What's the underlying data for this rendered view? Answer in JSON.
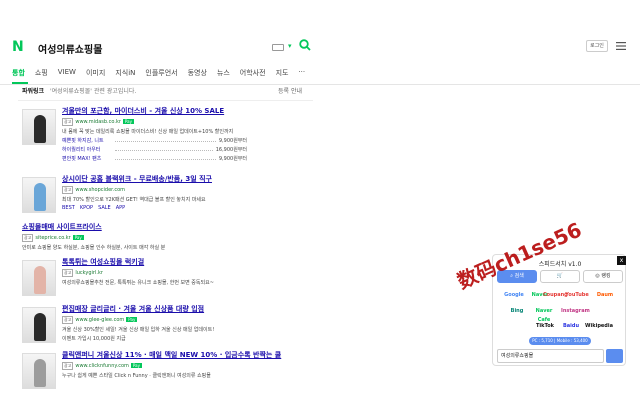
{
  "header": {
    "logo": "N",
    "query": "여성의류쇼핑몰",
    "login_label": "로그인"
  },
  "tabs": [
    "통합",
    "쇼핑",
    "VIEW",
    "이미지",
    "지식iN",
    "인플루언서",
    "동영상",
    "뉴스",
    "어학사전",
    "지도",
    "···"
  ],
  "powerlink": {
    "title": "파워링크",
    "query_note": "'여성의류쇼핑몰' 관련 광고입니다.",
    "info": "등록 안내",
    "ads": [
      {
        "title": "겨울만의 포근함, 마이더스비 - 겨울 신상 10% SALE",
        "url": "www.midasb.co.kr",
        "badge": "Pay",
        "desc": "내 몸에 꼭 맞는 데일리룩 쇼핑몰 마이더스비! 신상 매일 업데이트+10% 할인까지",
        "sub": [
          {
            "label": "예쁜핏 하지감, 니트",
            "price": "9,900원부터"
          },
          {
            "label": "하이퀄리티 아우터",
            "price": "16,900원부터"
          },
          {
            "label": "편안핏 MAX! 팬츠",
            "price": "9,900원부터"
          }
        ]
      },
      {
        "title": "상시이단 공홈 블랙위크 - 무료배송/반품, 3일 직구",
        "url": "www.shopcider.com",
        "desc": "최대 70% 할인으로 Y2K패션 GET! 역대급 블프 할인 놓치지 마세요",
        "links": [
          "BEST",
          "KPOP",
          "SALE",
          "APP"
        ]
      },
      {
        "title": "쇼핑몰매매 사이트프라이스",
        "url": "siteprice.co.kr",
        "badge": "Pay",
        "desc": "안미로 쇼핑몰 양도 하실분, 쇼핑몰 인수 하실분, 사이트 매각 하실 분"
      },
      {
        "title": "톡톡튀는 여성쇼핑몰 럭키걸",
        "url": "luckygirl.kr",
        "desc": "여성의류쇼핑몰추천 전문, 톡톡튀는 유니크 쇼핑몰, 한번 보면 중독되요~"
      },
      {
        "title": "편집매장 글리글리 · 겨울 겨울 신상품 대량 입점",
        "url": "www.glee-glee.com",
        "badge": "Pay",
        "desc": "겨울 신상 30%할인 세일! 겨울 신상 매일 입하 겨울 신상 매일 업데이트!",
        "extra": "이벤트 가입시 10,000원 지급"
      },
      {
        "title": "클릭앤퍼니 겨울신상 11% · 매일 맥일 NEW 10% · 입금수록 반짝는 쿨",
        "url": "www.clicknfunny.com",
        "badge": "Pay",
        "desc": "누구나 쉽게 예쁜 스타일 Click n Funny · 클릭앤퍼니 여성의류 쇼핑몰"
      }
    ]
  },
  "extension": {
    "title": "스피드서치 v1.0",
    "close_label": "x",
    "buttons": [
      "검색",
      "",
      "랭킹"
    ],
    "engines_row1": [
      "Google",
      "Naver",
      "Coupang",
      "YouTube",
      "Daum"
    ],
    "engines_row2": [
      "Bing",
      "Naver Cafe",
      "Instagram",
      "",
      ""
    ],
    "engines_row3": [
      "",
      "TikTok",
      "Baidu",
      "Wikipedia",
      ""
    ],
    "stats": "PC : 5,710 | Mobile : 53,400",
    "input_value": "여성의류쇼핑몰"
  },
  "watermark": "数码ch1se56"
}
